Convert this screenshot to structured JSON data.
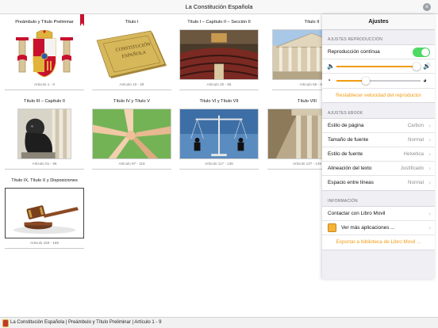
{
  "window": {
    "title": "La Constitución Española"
  },
  "tiles": [
    {
      "title": "Preámbulo y Título Preliminar",
      "range": "Articulo 1 - 9",
      "image": "spain-coat-of-arms"
    },
    {
      "title": "Título I",
      "range": "Articulo 10 - 29",
      "image": "constitution-book"
    },
    {
      "title": "Título I – Capítulo II – Sección II",
      "range": "Articulo 30 - 55",
      "image": "parliament-hall"
    },
    {
      "title": "Título II",
      "range": "Articulo 56 - 65",
      "image": "congress-building"
    },
    {
      "title": "Título III – Capítulo II",
      "range": "Articulo 81 - 96",
      "image": "lion-statue"
    },
    {
      "title": "Título IV y Título V",
      "range": "Articulo 97 - 116",
      "image": "joined-hands"
    },
    {
      "title": "Título VI y Título VII",
      "range": "Articulo 117 - 136",
      "image": "justice-scale"
    },
    {
      "title": "Título VIII",
      "range": "Articulo 137 - 149",
      "image": "building-columns"
    },
    {
      "title": "Título IX, Título X y Disposiciones",
      "range": "Articulo 159 - 169",
      "image": "gavel"
    }
  ],
  "status_bar": {
    "text": "La Constitución Española | Preámbulo y Título Preliminar | Artículo 1 - 9"
  },
  "settings": {
    "title": "Ajustes",
    "playback": {
      "section_label": "AJUSTES REPRODUCCIÓN",
      "continuous_label": "Reproducción contínua",
      "continuous_on": true,
      "volume_level": 0.95,
      "speed_level": 0.35,
      "reset_label": "Restablecer velocidad del reproductor"
    },
    "ebook": {
      "section_label": "AJUSTES EBOOK",
      "rows": [
        {
          "label": "Estilo de página",
          "value": "Carbon"
        },
        {
          "label": "Tamaño de fuente",
          "value": "Normal"
        },
        {
          "label": "Estilo de fuente",
          "value": "Helvetica"
        },
        {
          "label": "Alineación del texto",
          "value": "Justificado"
        },
        {
          "label": "Espacio entre líneas",
          "value": "Normal"
        }
      ]
    },
    "info": {
      "section_label": "INFORMACIÓN",
      "contact_label": "Contactar con Libro Movil",
      "more_apps_label": "Ver más aplicaciones ...",
      "export_label": "Exportar a biblioteca de Libro Movil ..."
    },
    "accent_color": "#f39c12",
    "toggle_color": "#4cd964"
  }
}
